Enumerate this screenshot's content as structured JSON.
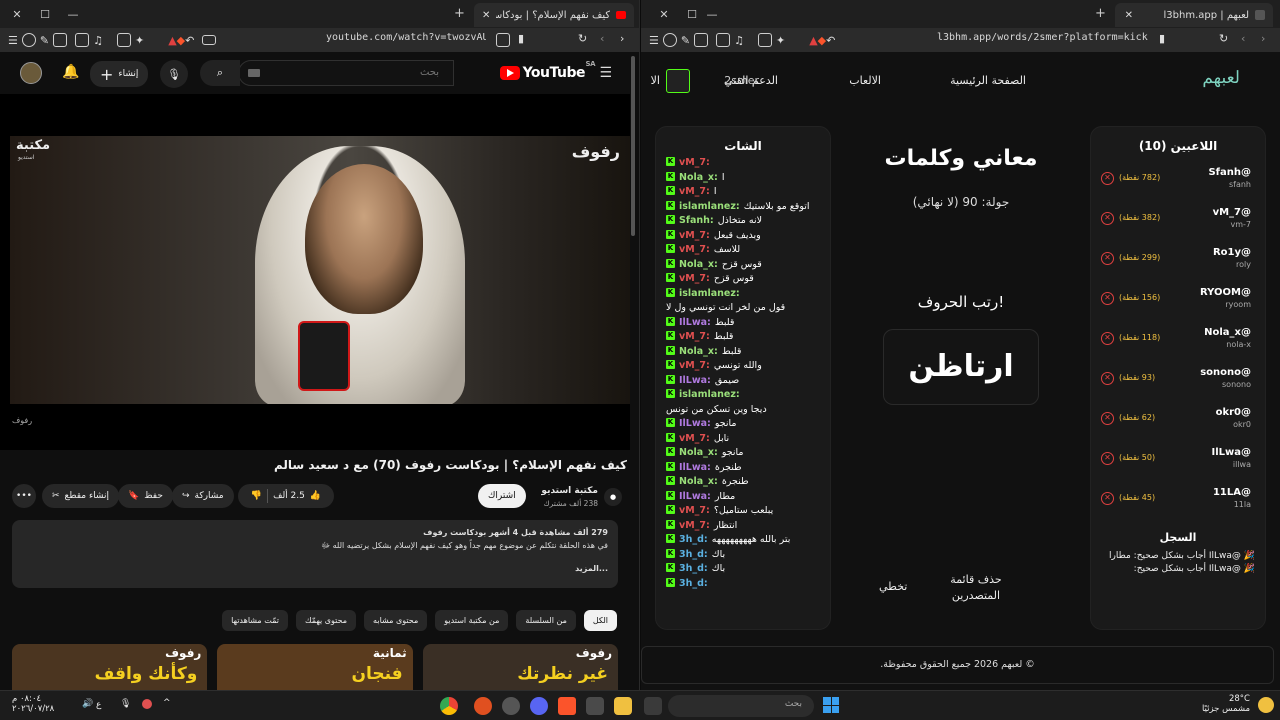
{
  "left_window": {
    "tab_title": "كيف نفهم الإسلام؟ | بودكاست ر",
    "url": "youtube.com/watch?v=twozvAUO6Qg",
    "youtube": {
      "logo": "YouTube",
      "logo_sup": "SA",
      "search_placeholder": "بحث",
      "create_label": "إنشاء",
      "video_overlay_brand": "رفوف",
      "video_overlay_channel": "مكتبة",
      "video_overlay_sub": "استديو",
      "video_corner": "رفوف",
      "title": "كيف نفهم الإسلام؟ | بودكاست رفوف (70) مع د سعيد سالم",
      "channel_name": "مكتبة استديو",
      "channel_subs": "238 ألف مشترك",
      "subscribe_label": "اشتراك",
      "likes": "2.5 ألف",
      "share_label": "مشاركة",
      "save_label": "حفظ",
      "clip_label": "إنشاء مقطع",
      "desc_meta": "279 ألف مشاهدة  قبل 4 أشهر  بودكاست رفوف",
      "desc_text": "في هذه الحلقة نتكلم عن موضوع مهم جداً وهو كيف نفهم الإسلام بشكل يرتضيه الله ﷻ",
      "desc_more": "...المزيد",
      "chips": [
        "الكل",
        "من السلسلة",
        "من مكتبة استديو",
        "محتوى مشابه",
        "محتوى يهمّك",
        "تمّت مشاهدتها"
      ],
      "thumbs": [
        {
          "text": "غير نظرتك",
          "brand": "رفوف",
          "color": "#3a2f25"
        },
        {
          "text": "فنجان",
          "brand": "ثمانية",
          "color": "#5a3b1e"
        },
        {
          "text": "وكأنك واقف",
          "brand": "رفوف",
          "color": "#4b3520"
        }
      ]
    }
  },
  "right_window": {
    "tab_title": "لعبهم | l3bhm.app",
    "url": "l3bhm.app/words/2smer?platform=kick",
    "nav": {
      "logo": "لعبهم",
      "home": "الصفحة الرئيسية",
      "games": "الالعاب",
      "support": "الدعم الفني",
      "user": "2smer",
      "extra": "الا"
    },
    "players_title": "اللاعبين (10)",
    "players": [
      {
        "name": "@Sfanh",
        "sub": "sfanh",
        "points": "(782 نقطة)"
      },
      {
        "name": "@vM_7",
        "sub": "vm-7",
        "points": "(382 نقطة)"
      },
      {
        "name": "@Ro1y",
        "sub": "roly",
        "points": "(299 نقطة)"
      },
      {
        "name": "@RYOOM",
        "sub": "ryoom",
        "points": "(156 نقطة)"
      },
      {
        "name": "@Nola_x",
        "sub": "nola-x",
        "points": "(118 نقطة)"
      },
      {
        "name": "@sonono",
        "sub": "sonono",
        "points": "(93 نقطة)"
      },
      {
        "name": "@okr0",
        "sub": "okr0",
        "points": "(62 نقطة)"
      },
      {
        "name": "@IlLwa",
        "sub": "illwa",
        "points": "(50 نقطة)"
      },
      {
        "name": "@11LA",
        "sub": "11la",
        "points": "(45 نقطة)"
      }
    ],
    "log_title": "السجل",
    "log": [
      "@IlLwa أجاب بشكل صحيح: مطارا",
      "@IlLwa أجاب بشكل صحيح:"
    ],
    "game": {
      "title": "معاني وكلمات",
      "round": "جولة: 90 (لا نهائي)",
      "prompt": "رتب الحروف!",
      "scrambled": "ارتاظن",
      "reset_label": "حذف قائمة المتصدرين",
      "skip_label": "تخطي"
    },
    "chat_title": "الشات",
    "chat": [
      {
        "user": "vM_7:",
        "text": "",
        "color": "#e05050"
      },
      {
        "user": "Nola_x:",
        "text": "ا",
        "color": "#9adf7a"
      },
      {
        "user": "vM_7:",
        "text": "ا",
        "color": "#e05050"
      },
      {
        "user": "islamlanez:",
        "text": "اتوقع مو بلاستيك",
        "color": "#9adf7a"
      },
      {
        "user": "Sfanh:",
        "text": "لانه متخاذل",
        "color": "#9adf7a"
      },
      {
        "user": "vM_7:",
        "text": "وبديف قبعل",
        "color": "#e05050"
      },
      {
        "user": "vM_7:",
        "text": "للاسف",
        "color": "#e05050"
      },
      {
        "user": "Nola_x:",
        "text": "قوس قزح",
        "color": "#9adf7a"
      },
      {
        "user": "vM_7:",
        "text": "قوس قزح",
        "color": "#e05050"
      },
      {
        "user": "islamlanez:",
        "text": "",
        "color": "#9adf7a"
      },
      {
        "user": "",
        "text": "قول من لخر انت تونسي ول لا",
        "color": "#9adf7a"
      },
      {
        "user": "IlLwa:",
        "text": "قلبط",
        "color": "#b07ae0"
      },
      {
        "user": "vM_7:",
        "text": "قلبط",
        "color": "#e05050"
      },
      {
        "user": "Nola_x:",
        "text": "قلبط",
        "color": "#9adf7a"
      },
      {
        "user": "vM_7:",
        "text": "والله تونسي",
        "color": "#e05050"
      },
      {
        "user": "IlLwa:",
        "text": "صيمق",
        "color": "#b07ae0"
      },
      {
        "user": "islamlanez:",
        "text": "",
        "color": "#9adf7a"
      },
      {
        "user": "",
        "text": "ديجا وين تسكن من تونس",
        "color": "#9adf7a"
      },
      {
        "user": "IlLwa:",
        "text": "مانجو",
        "color": "#b07ae0"
      },
      {
        "user": "vM_7:",
        "text": "نابل",
        "color": "#e05050"
      },
      {
        "user": "Nola_x:",
        "text": "مانجو",
        "color": "#9adf7a"
      },
      {
        "user": "IlLwa:",
        "text": "طنجرة",
        "color": "#b07ae0"
      },
      {
        "user": "Nola_x:",
        "text": "طنجرة",
        "color": "#9adf7a"
      },
      {
        "user": "IlLwa:",
        "text": "مطار",
        "color": "#b07ae0"
      },
      {
        "user": "vM_7:",
        "text": "يبلعب ستاميل؟",
        "color": "#e05050"
      },
      {
        "user": "vM_7:",
        "text": "انتظار",
        "color": "#e05050"
      },
      {
        "user": "3h_d:",
        "text": "بتر بالله هههههههههه",
        "color": "#5ab0e0"
      },
      {
        "user": "3h_d:",
        "text": "باك",
        "color": "#5ab0e0"
      },
      {
        "user": "3h_d:",
        "text": "باك",
        "color": "#5ab0e0"
      },
      {
        "user": "3h_d:",
        "text": "",
        "color": "#5ab0e0"
      }
    ],
    "footer": "© لعبهم 2026 جميع الحقوق محفوظة."
  },
  "taskbar": {
    "weather_temp": "28°C",
    "weather_desc": "مشمس جزئيًا",
    "search_placeholder": "بحث",
    "time": "٠٨:٠٤ م",
    "date": "٢٠٢٦/٠٧/٢٨",
    "lang": "ع"
  }
}
